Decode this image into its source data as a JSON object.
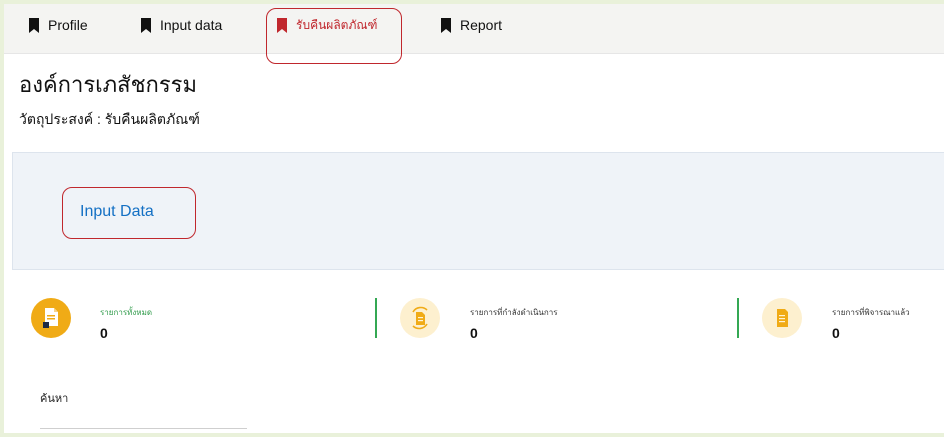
{
  "tabs": [
    {
      "label": "Profile",
      "icon": "bookmark-icon",
      "active": false
    },
    {
      "label": "Input data",
      "icon": "bookmark-icon",
      "active": false
    },
    {
      "label": "รับคืนผลิตภัณฑ์",
      "icon": "bookmark-icon",
      "active": true
    },
    {
      "label": "Report",
      "icon": "bookmark-icon",
      "active": false
    }
  ],
  "header": {
    "title": "องค์การเภสัชกรรม",
    "subtitle": "วัตถุประสงค์ : รับคืนผลิตภัณฑ์"
  },
  "panel": {
    "input_link": "Input Data"
  },
  "stats": [
    {
      "label": "รายการทั้งหมด",
      "value": "0",
      "icon": "document-icon"
    },
    {
      "label": "รายการที่กำลังดำเนินการ",
      "value": "0",
      "icon": "document-sync-icon"
    },
    {
      "label": "รายการที่พิจารณาแล้ว",
      "value": "0",
      "icon": "document-list-icon"
    }
  ],
  "search": {
    "label": "ค้นหา"
  },
  "colors": {
    "accent_red": "#c0272d",
    "link_blue": "#1470c4",
    "green": "#34a853",
    "panel_bg": "#eff3f8",
    "tabbar_bg": "#f4f4f2",
    "stat_icon_active": "#f0ab16",
    "stat_icon_soft": "#fdf0cf"
  }
}
